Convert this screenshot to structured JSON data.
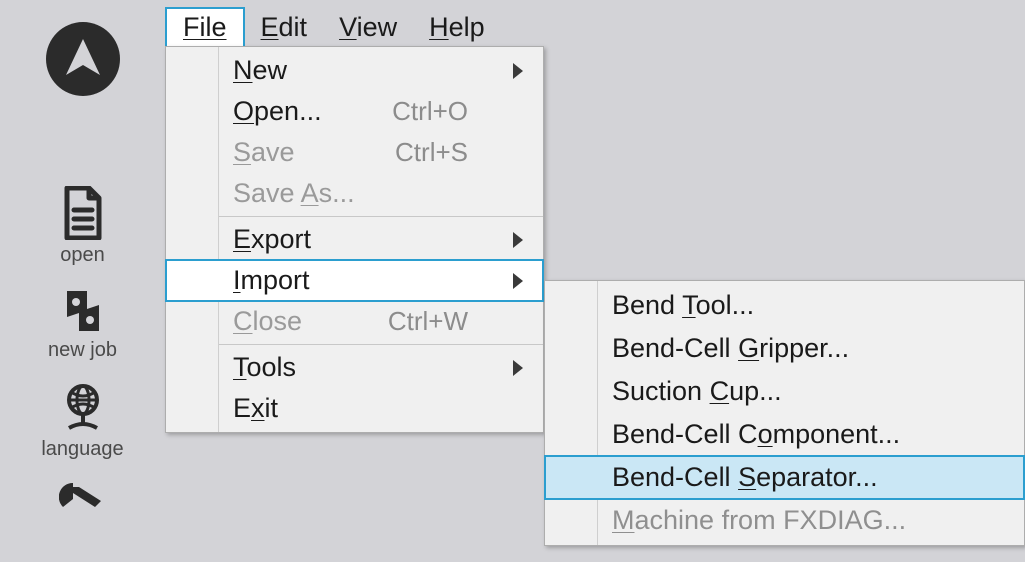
{
  "sidebar": {
    "open_label": "open",
    "newjob_label": "new job",
    "language_label": "language"
  },
  "menubar": {
    "file": "File",
    "edit": "Edit",
    "view": "View",
    "help": "Help"
  },
  "file_menu": {
    "new": "New",
    "open": "Open...",
    "open_sc": "Ctrl+O",
    "save": "Save",
    "save_sc": "Ctrl+S",
    "saveas": "Save As...",
    "export": "Export",
    "import": "Import",
    "close": "Close",
    "close_sc": "Ctrl+W",
    "tools": "Tools",
    "exit": "Exit"
  },
  "import_menu": {
    "bendtool": "Bend Tool...",
    "gripper": "Bend-Cell Gripper...",
    "cup": "Suction Cup...",
    "component": "Bend-Cell Component...",
    "separator": "Bend-Cell Separator...",
    "machine": "Machine from FXDIAG..."
  }
}
